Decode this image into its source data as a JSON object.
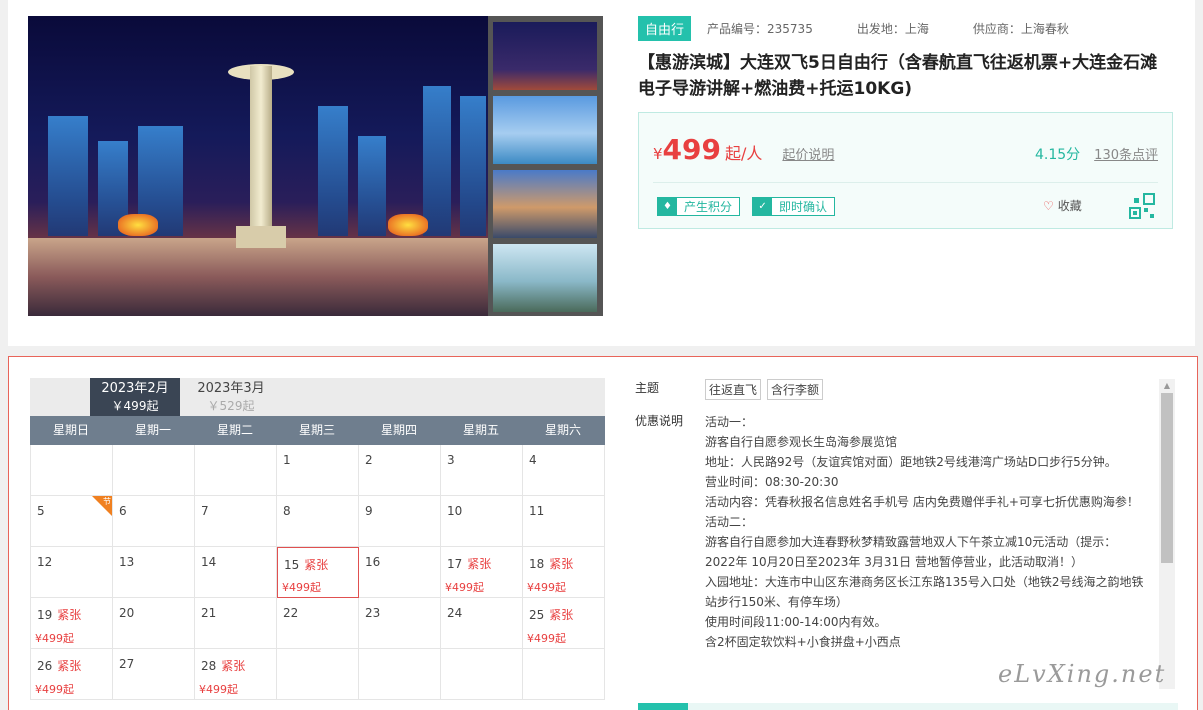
{
  "product": {
    "type_tag": "自由行",
    "code": "产品编号：235735",
    "departure": "出发地：上海",
    "supplier": "供应商：上海春秋",
    "title": "【惠游滨城】大连双飞5日自由行（含春航直飞往返机票+大连金石滩电子导游讲解+燃油费+托运10KG)",
    "currency": "¥",
    "price": "499",
    "price_unit": "起/人",
    "price_note_link": "起价说明",
    "score": "4.15分",
    "reviews_link": "130条点评",
    "badges": [
      "产生积分",
      "即时确认"
    ],
    "favorite": "收藏"
  },
  "calendar": {
    "months": [
      {
        "label": "2023年2月",
        "price": "￥499起"
      },
      {
        "label": "2023年3月",
        "price": "￥529起"
      }
    ],
    "weekdays": [
      "星期日",
      "星期一",
      "星期二",
      "星期三",
      "星期四",
      "星期五",
      "星期六"
    ],
    "holiday_mark": "节",
    "rows": [
      [
        {
          "d": ""
        },
        {
          "d": ""
        },
        {
          "d": ""
        },
        {
          "d": "1"
        },
        {
          "d": "2"
        },
        {
          "d": "3"
        },
        {
          "d": "4"
        }
      ],
      [
        {
          "d": "5",
          "holiday": true
        },
        {
          "d": "6"
        },
        {
          "d": "7"
        },
        {
          "d": "8"
        },
        {
          "d": "9"
        },
        {
          "d": "10"
        },
        {
          "d": "11"
        }
      ],
      [
        {
          "d": "12"
        },
        {
          "d": "13"
        },
        {
          "d": "14"
        },
        {
          "d": "15",
          "s": "紧张",
          "p": "¥499起",
          "sel": true
        },
        {
          "d": "16"
        },
        {
          "d": "17",
          "s": "紧张",
          "p": "¥499起"
        },
        {
          "d": "18",
          "s": "紧张",
          "p": "¥499起"
        }
      ],
      [
        {
          "d": "19",
          "s": "紧张",
          "p": "¥499起"
        },
        {
          "d": "20"
        },
        {
          "d": "21"
        },
        {
          "d": "22"
        },
        {
          "d": "23"
        },
        {
          "d": "24"
        },
        {
          "d": "25",
          "s": "紧张",
          "p": "¥499起"
        }
      ],
      [
        {
          "d": "26",
          "s": "紧张",
          "p": "¥499起"
        },
        {
          "d": "27"
        },
        {
          "d": "28",
          "s": "紧张",
          "p": "¥499起"
        },
        {
          "d": ""
        },
        {
          "d": ""
        },
        {
          "d": ""
        },
        {
          "d": ""
        }
      ]
    ]
  },
  "details": {
    "theme_label": "主题",
    "theme_chips": [
      "往返直飞",
      "含行李额"
    ],
    "promo_label": "优惠说明",
    "promo_lines": [
      "活动一：",
      "游客自行自愿参观长生岛海参展览馆",
      "地址：人民路92号（友谊宾馆对面）距地铁2号线港湾广场站D口步行5分钟。",
      "营业时间：08:30-20:30",
      "活动内容：凭春秋报名信息姓名手机号 店内免费赠伴手礼+可享七折优惠购海参！",
      "活动二：",
      "游客自行自愿参加大连春野秋梦精致露营地双人下午茶立减10元活动（提示：2022年 10月20日至2023年 3月31日 营地暂停营业，此活动取消！）",
      "入园地址：大连市中山区东港商务区长江东路135号入口处（地铁2号线海之韵地铁站步行150米、有停车场）",
      "使用时间段11:00-14:00内有效。",
      "含2杯固定软饮料+小食拼盘+小西点"
    ]
  },
  "watermark": "eLvXing.net"
}
